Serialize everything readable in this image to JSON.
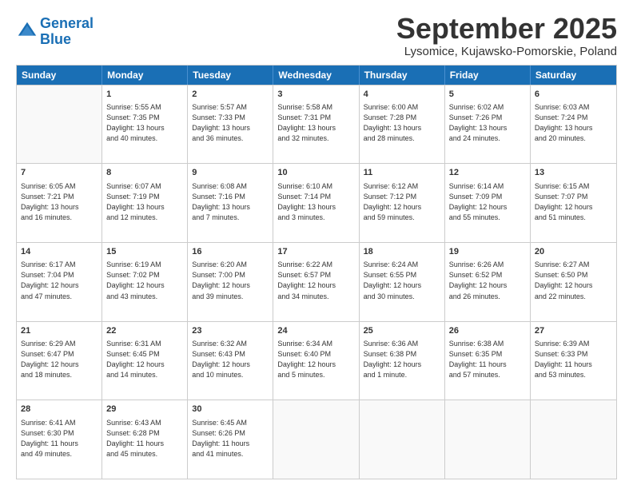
{
  "logo": {
    "line1": "General",
    "line2": "Blue"
  },
  "title": "September 2025",
  "location": "Lysomice, Kujawsko-Pomorskie, Poland",
  "headers": [
    "Sunday",
    "Monday",
    "Tuesday",
    "Wednesday",
    "Thursday",
    "Friday",
    "Saturday"
  ],
  "weeks": [
    [
      {
        "day": "",
        "text": ""
      },
      {
        "day": "1",
        "text": "Sunrise: 5:55 AM\nSunset: 7:35 PM\nDaylight: 13 hours\nand 40 minutes."
      },
      {
        "day": "2",
        "text": "Sunrise: 5:57 AM\nSunset: 7:33 PM\nDaylight: 13 hours\nand 36 minutes."
      },
      {
        "day": "3",
        "text": "Sunrise: 5:58 AM\nSunset: 7:31 PM\nDaylight: 13 hours\nand 32 minutes."
      },
      {
        "day": "4",
        "text": "Sunrise: 6:00 AM\nSunset: 7:28 PM\nDaylight: 13 hours\nand 28 minutes."
      },
      {
        "day": "5",
        "text": "Sunrise: 6:02 AM\nSunset: 7:26 PM\nDaylight: 13 hours\nand 24 minutes."
      },
      {
        "day": "6",
        "text": "Sunrise: 6:03 AM\nSunset: 7:24 PM\nDaylight: 13 hours\nand 20 minutes."
      }
    ],
    [
      {
        "day": "7",
        "text": "Sunrise: 6:05 AM\nSunset: 7:21 PM\nDaylight: 13 hours\nand 16 minutes."
      },
      {
        "day": "8",
        "text": "Sunrise: 6:07 AM\nSunset: 7:19 PM\nDaylight: 13 hours\nand 12 minutes."
      },
      {
        "day": "9",
        "text": "Sunrise: 6:08 AM\nSunset: 7:16 PM\nDaylight: 13 hours\nand 7 minutes."
      },
      {
        "day": "10",
        "text": "Sunrise: 6:10 AM\nSunset: 7:14 PM\nDaylight: 13 hours\nand 3 minutes."
      },
      {
        "day": "11",
        "text": "Sunrise: 6:12 AM\nSunset: 7:12 PM\nDaylight: 12 hours\nand 59 minutes."
      },
      {
        "day": "12",
        "text": "Sunrise: 6:14 AM\nSunset: 7:09 PM\nDaylight: 12 hours\nand 55 minutes."
      },
      {
        "day": "13",
        "text": "Sunrise: 6:15 AM\nSunset: 7:07 PM\nDaylight: 12 hours\nand 51 minutes."
      }
    ],
    [
      {
        "day": "14",
        "text": "Sunrise: 6:17 AM\nSunset: 7:04 PM\nDaylight: 12 hours\nand 47 minutes."
      },
      {
        "day": "15",
        "text": "Sunrise: 6:19 AM\nSunset: 7:02 PM\nDaylight: 12 hours\nand 43 minutes."
      },
      {
        "day": "16",
        "text": "Sunrise: 6:20 AM\nSunset: 7:00 PM\nDaylight: 12 hours\nand 39 minutes."
      },
      {
        "day": "17",
        "text": "Sunrise: 6:22 AM\nSunset: 6:57 PM\nDaylight: 12 hours\nand 34 minutes."
      },
      {
        "day": "18",
        "text": "Sunrise: 6:24 AM\nSunset: 6:55 PM\nDaylight: 12 hours\nand 30 minutes."
      },
      {
        "day": "19",
        "text": "Sunrise: 6:26 AM\nSunset: 6:52 PM\nDaylight: 12 hours\nand 26 minutes."
      },
      {
        "day": "20",
        "text": "Sunrise: 6:27 AM\nSunset: 6:50 PM\nDaylight: 12 hours\nand 22 minutes."
      }
    ],
    [
      {
        "day": "21",
        "text": "Sunrise: 6:29 AM\nSunset: 6:47 PM\nDaylight: 12 hours\nand 18 minutes."
      },
      {
        "day": "22",
        "text": "Sunrise: 6:31 AM\nSunset: 6:45 PM\nDaylight: 12 hours\nand 14 minutes."
      },
      {
        "day": "23",
        "text": "Sunrise: 6:32 AM\nSunset: 6:43 PM\nDaylight: 12 hours\nand 10 minutes."
      },
      {
        "day": "24",
        "text": "Sunrise: 6:34 AM\nSunset: 6:40 PM\nDaylight: 12 hours\nand 5 minutes."
      },
      {
        "day": "25",
        "text": "Sunrise: 6:36 AM\nSunset: 6:38 PM\nDaylight: 12 hours\nand 1 minute."
      },
      {
        "day": "26",
        "text": "Sunrise: 6:38 AM\nSunset: 6:35 PM\nDaylight: 11 hours\nand 57 minutes."
      },
      {
        "day": "27",
        "text": "Sunrise: 6:39 AM\nSunset: 6:33 PM\nDaylight: 11 hours\nand 53 minutes."
      }
    ],
    [
      {
        "day": "28",
        "text": "Sunrise: 6:41 AM\nSunset: 6:30 PM\nDaylight: 11 hours\nand 49 minutes."
      },
      {
        "day": "29",
        "text": "Sunrise: 6:43 AM\nSunset: 6:28 PM\nDaylight: 11 hours\nand 45 minutes."
      },
      {
        "day": "30",
        "text": "Sunrise: 6:45 AM\nSunset: 6:26 PM\nDaylight: 11 hours\nand 41 minutes."
      },
      {
        "day": "",
        "text": ""
      },
      {
        "day": "",
        "text": ""
      },
      {
        "day": "",
        "text": ""
      },
      {
        "day": "",
        "text": ""
      }
    ]
  ]
}
